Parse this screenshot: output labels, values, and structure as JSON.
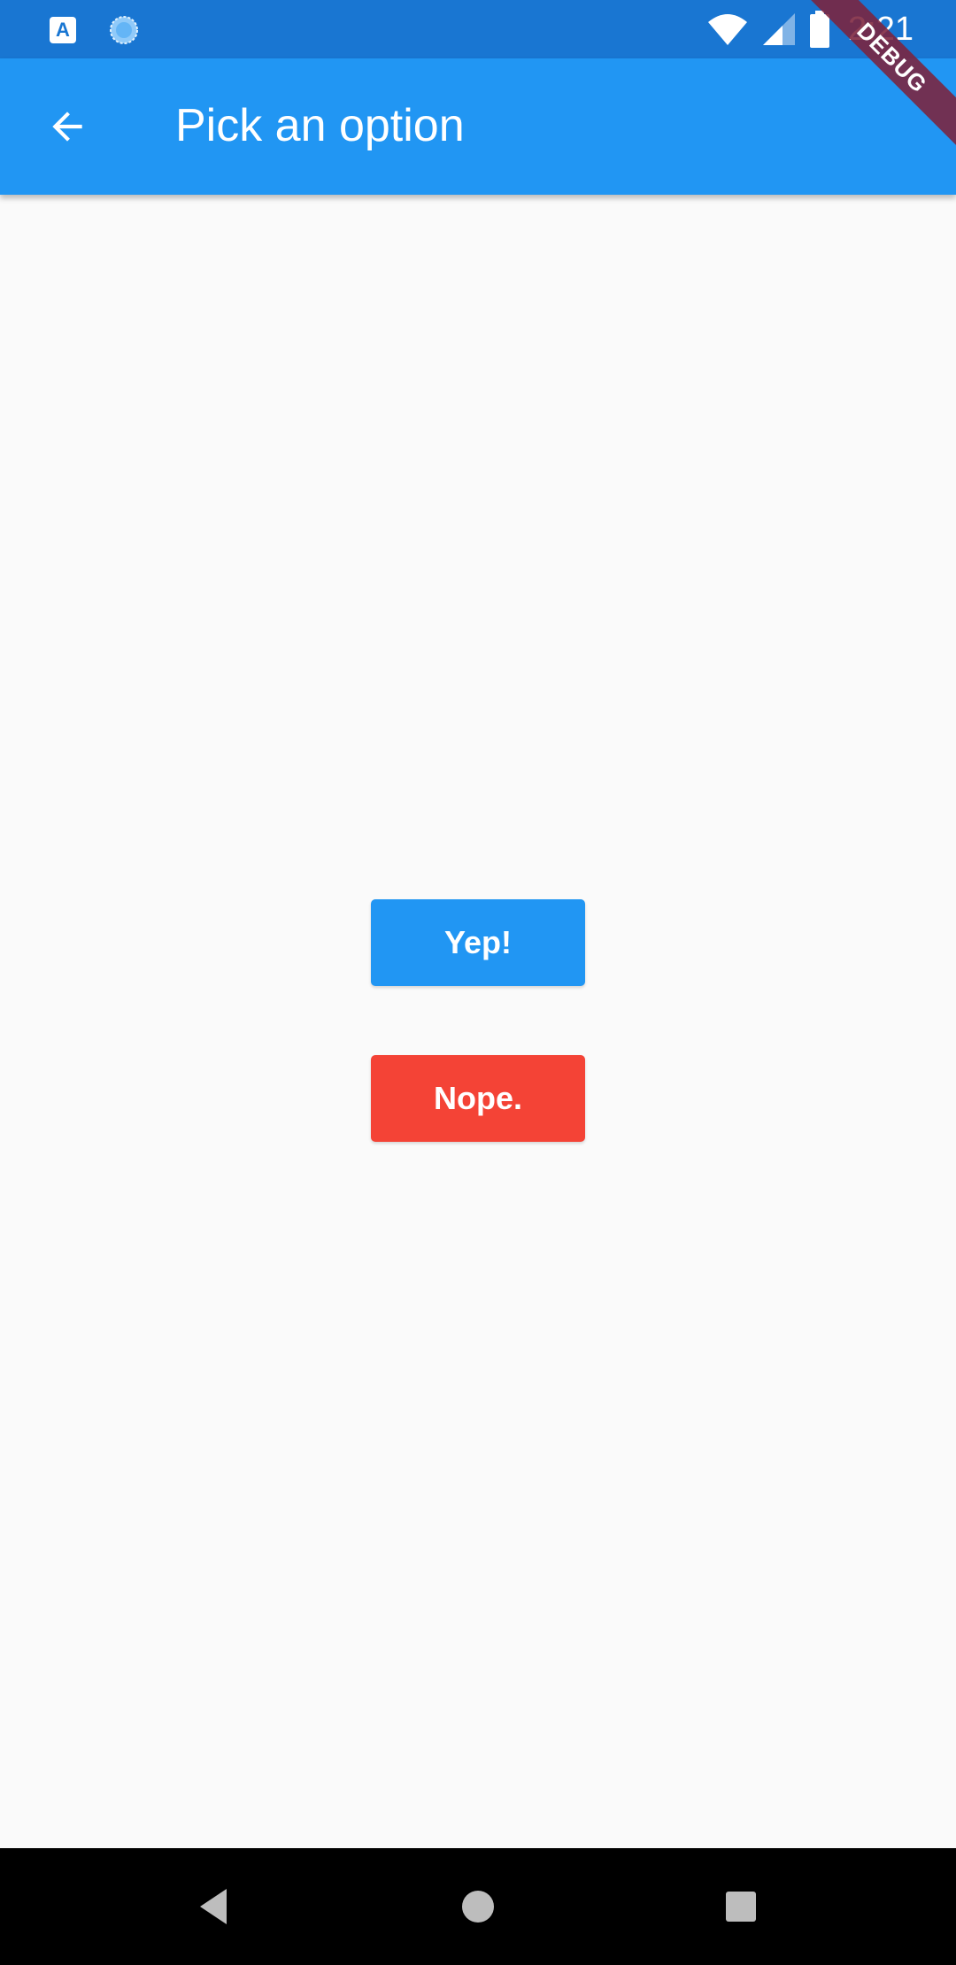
{
  "status_bar": {
    "time": "2:21",
    "app_icon_letter": "A",
    "icons": [
      "app-a-icon",
      "sync-icon",
      "wifi-icon",
      "signal-icon",
      "battery-icon"
    ]
  },
  "app_bar": {
    "title": "Pick an option",
    "back_icon": "arrow-back-icon",
    "color": "#2196f3"
  },
  "debug_banner": {
    "label": "DEBUG"
  },
  "options": {
    "yep": {
      "label": "Yep!",
      "color": "#2196f3"
    },
    "nope": {
      "label": "Nope.",
      "color": "#f44336"
    }
  },
  "nav_bar": {
    "icons": [
      "nav-back-icon",
      "nav-home-icon",
      "nav-recents-icon"
    ]
  }
}
